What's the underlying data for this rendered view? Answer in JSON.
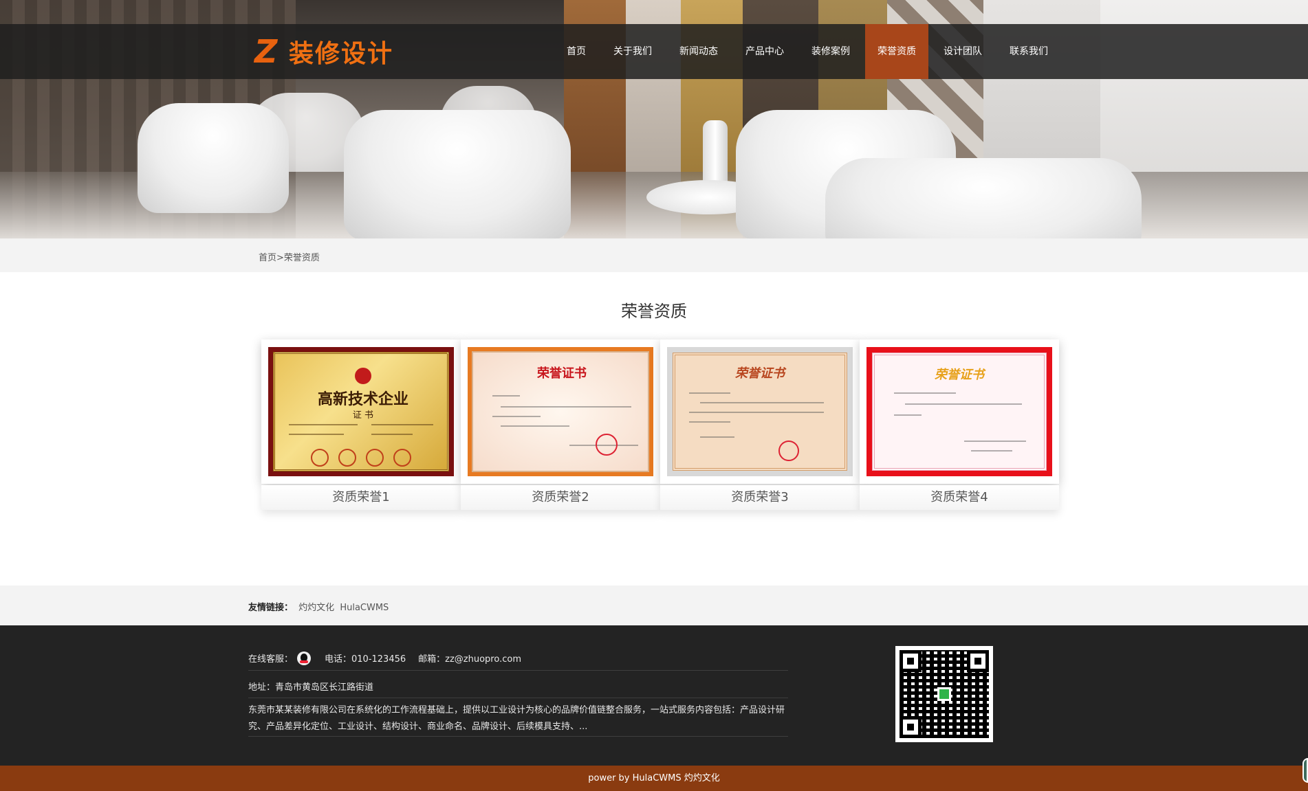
{
  "brand": {
    "logo_mark": "Z",
    "logo_text": "装修设计",
    "accent_color": "#f07012",
    "nav_active_color": "#a8461a"
  },
  "nav": {
    "items": [
      {
        "label": "首页",
        "active": false
      },
      {
        "label": "关于我们",
        "active": false
      },
      {
        "label": "新闻动态",
        "active": false
      },
      {
        "label": "产品中心",
        "active": false
      },
      {
        "label": "装修案例",
        "active": false
      },
      {
        "label": "荣誉资质",
        "active": true
      },
      {
        "label": "设计团队",
        "active": false
      },
      {
        "label": "联系我们",
        "active": false
      }
    ]
  },
  "breadcrumb": {
    "home": "首页",
    "separator": ">",
    "current": "荣誉资质"
  },
  "page": {
    "title": "荣誉资质"
  },
  "certificates": [
    {
      "caption": "资质荣誉1",
      "cert_title": "高新技术企业",
      "cert_subtitle": "证 书"
    },
    {
      "caption": "资质荣誉2",
      "cert_title": "荣誉证书"
    },
    {
      "caption": "资质荣誉3",
      "cert_title": "荣誉证书"
    },
    {
      "caption": "资质荣誉4",
      "cert_title": "荣誉证书"
    }
  ],
  "friend_links": {
    "label": "友情链接：",
    "items": [
      "灼灼文化",
      "HulaCWMS"
    ]
  },
  "footer": {
    "service_label": "在线客服：",
    "phone": "电话：010-123456",
    "email": "邮箱：zz@zhuopro.com",
    "address": "地址：青岛市黄岛区长江路街道",
    "description": "东莞市某某装修有限公司在系统化的工作流程基础上，提供以工业设计为核心的品牌价值链整合服务，一站式服务内容包括：产品设计研究、产品差异化定位、工业设计、结构设计、商业命名、品牌设计、后续模具支持、...",
    "qq_icon": "qq-icon",
    "qr_icon": "qr-code-icon"
  },
  "copyright": {
    "text": "power by HulaCWMS 灼灼文化"
  }
}
